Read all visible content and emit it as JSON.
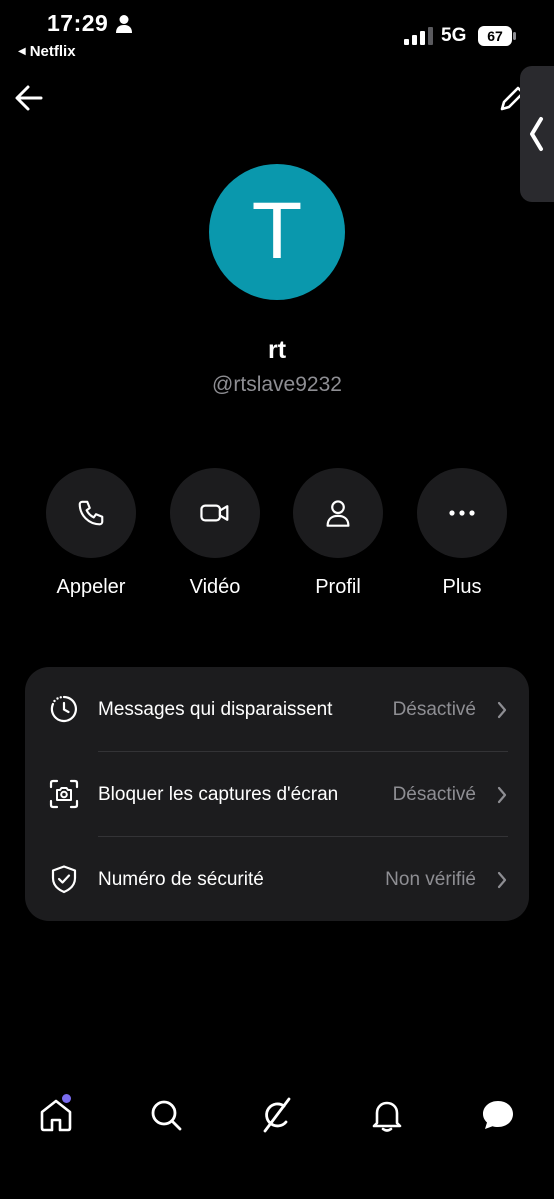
{
  "status_bar": {
    "time": "17:29",
    "back_app": "Netflix",
    "network": "5G",
    "battery": "67"
  },
  "profile": {
    "avatar_letter": "T",
    "avatar_color": "#0a98ad",
    "name": "rt",
    "handle": "@rtslave9232"
  },
  "actions": [
    {
      "label": "Appeler",
      "icon": "phone-icon"
    },
    {
      "label": "Vidéo",
      "icon": "video-icon"
    },
    {
      "label": "Profil",
      "icon": "person-icon"
    },
    {
      "label": "Plus",
      "icon": "more-icon"
    }
  ],
  "settings": [
    {
      "title": "Messages qui disparaissent",
      "value": "Désactivé",
      "icon": "timer-icon"
    },
    {
      "title": "Bloquer les captures d'écran",
      "value": "Désactivé",
      "icon": "camera-icon"
    },
    {
      "title": "Numéro de sécurité",
      "value": "Non vérifié",
      "icon": "shield-icon"
    }
  ],
  "bottom_nav": [
    {
      "name": "home",
      "icon": "home-icon"
    },
    {
      "name": "search",
      "icon": "search-icon"
    },
    {
      "name": "grok",
      "icon": "grok-icon"
    },
    {
      "name": "notifications",
      "icon": "bell-icon"
    },
    {
      "name": "messages",
      "icon": "message-icon"
    }
  ],
  "colors": {
    "background": "#000000",
    "card": "#1c1c1e",
    "secondary_text": "#8e8e93",
    "accent_dot": "#7a6cf0"
  }
}
